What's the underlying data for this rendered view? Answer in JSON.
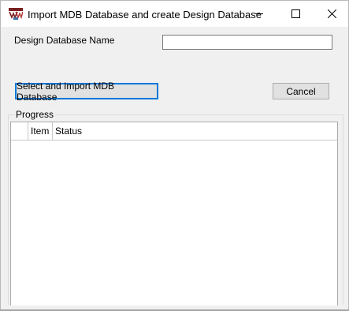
{
  "window": {
    "title": "Import MDB Database and create Design Database",
    "icon": "app-logo-icon",
    "controls": {
      "minimize": "minimize-icon",
      "maximize": "maximize-icon",
      "close": "close-icon"
    }
  },
  "form": {
    "name_label": "Design Database Name",
    "name_value": "",
    "import_button": "Select and Import MDB Database",
    "cancel_button": "Cancel"
  },
  "progress": {
    "group_label": "Progress",
    "columns": [
      "Item",
      "Status"
    ],
    "rows": []
  },
  "colors": {
    "window_bg": "#f0f0f0",
    "focus_border": "#0078d7",
    "button_bg": "#e1e1e1"
  }
}
